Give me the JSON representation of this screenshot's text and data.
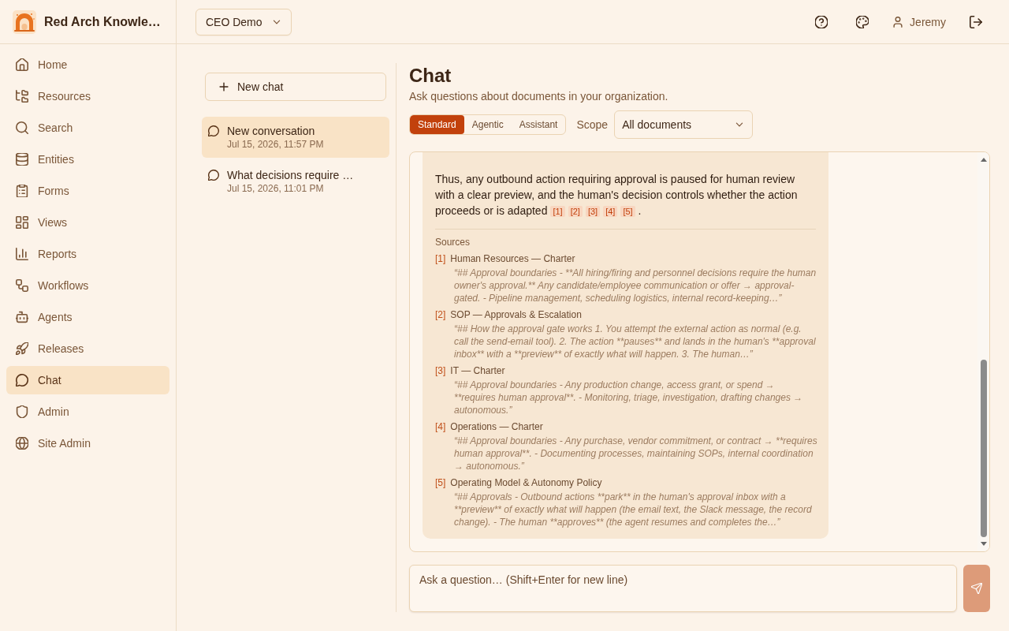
{
  "brand": {
    "name": "Red Arch Knowle…"
  },
  "topbar": {
    "workspace": "CEO Demo",
    "user": "Jeremy"
  },
  "sidebar": {
    "items": [
      {
        "label": "Home",
        "selected": false
      },
      {
        "label": "Resources",
        "selected": false
      },
      {
        "label": "Search",
        "selected": false
      },
      {
        "label": "Entities",
        "selected": false
      },
      {
        "label": "Forms",
        "selected": false
      },
      {
        "label": "Views",
        "selected": false
      },
      {
        "label": "Reports",
        "selected": false
      },
      {
        "label": "Workflows",
        "selected": false
      },
      {
        "label": "Agents",
        "selected": false
      },
      {
        "label": "Releases",
        "selected": false
      },
      {
        "label": "Chat",
        "selected": true
      },
      {
        "label": "Admin",
        "selected": false
      },
      {
        "label": "Site Admin",
        "selected": false
      }
    ]
  },
  "chat_list": {
    "new_chat": "New chat",
    "conversations": [
      {
        "title": "New conversation",
        "time": "Jul 15, 2026, 11:57 PM",
        "selected": true
      },
      {
        "title": "What decisions require …",
        "time": "Jul 15, 2026, 11:01 PM",
        "selected": false
      }
    ]
  },
  "page": {
    "title": "Chat",
    "subtitle": "Ask questions about documents in your organization."
  },
  "modes": [
    {
      "label": "Standard",
      "selected": true
    },
    {
      "label": "Agentic",
      "selected": false
    },
    {
      "label": "Assistant",
      "selected": false
    }
  ],
  "scope": {
    "label": "Scope",
    "value": "All documents"
  },
  "message": {
    "text": "Thus, any outbound action requiring approval is paused for human review with a clear preview, and the human's decision controls whether the action proceeds or is adapted",
    "citations": [
      "[1]",
      "[2]",
      "[3]",
      "[4]",
      "[5]"
    ],
    "end": "."
  },
  "sources": {
    "heading": "Sources",
    "items": [
      {
        "ref": "[1]",
        "title": "Human Resources — Charter",
        "excerpt": "“## Approval boundaries - **All hiring/firing and personnel decisions require the human owner's approval.** Any candidate/employee communication or offer → approval-gated. - Pipeline management, scheduling logistics, internal record-keeping…”"
      },
      {
        "ref": "[2]",
        "title": "SOP — Approvals & Escalation",
        "excerpt": "“## How the approval gate works 1. You attempt the external action as normal (e.g. call the send-email tool). 2. The action **pauses** and lands in the human's **approval inbox** with a **preview** of exactly what will happen. 3. The human…”"
      },
      {
        "ref": "[3]",
        "title": "IT — Charter",
        "excerpt": "“## Approval boundaries - Any production change, access grant, or spend → **requires human approval**. - Monitoring, triage, investigation, drafting changes → autonomous.”"
      },
      {
        "ref": "[4]",
        "title": "Operations — Charter",
        "excerpt": "“## Approval boundaries - Any purchase, vendor commitment, or contract → **requires human approval**. - Documenting processes, maintaining SOPs, internal coordination → autonomous.”"
      },
      {
        "ref": "[5]",
        "title": "Operating Model & Autonomy Policy",
        "excerpt": "“## Approvals - Outbound actions **park** in the human's approval inbox with a **preview** of exactly what will happen (the email text, the Slack message, the record change). - The human **approves** (the agent resumes and completes the…”"
      }
    ]
  },
  "composer": {
    "placeholder": "Ask a question… (Shift+Enter for new line)"
  }
}
